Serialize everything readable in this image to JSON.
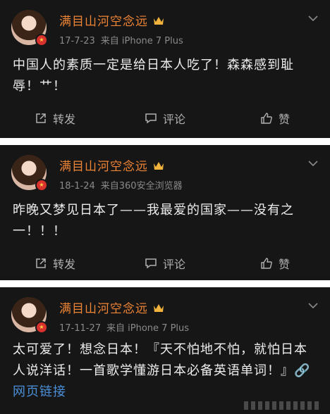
{
  "posts": [
    {
      "username": "满目山河空念远",
      "date": "17-7-23",
      "source": "来自 iPhone 7 Plus",
      "content": "中国人的素质一定是给日本人吃了！森森感到耻辱！艹！",
      "link": "",
      "actions": {
        "repost": "转发",
        "comment": "评论",
        "like": "赞"
      }
    },
    {
      "username": "满目山河空念远",
      "date": "18-1-24",
      "source": "来自360安全浏览器",
      "content": "昨晚又梦见日本了——我最爱的国家——没有之一！！！",
      "link": "",
      "actions": {
        "repost": "转发",
        "comment": "评论",
        "like": "赞"
      }
    },
    {
      "username": "满目山河空念远",
      "date": "17-11-27",
      "source": "来自 iPhone 7 Plus",
      "content": "太可爱了！想念日本！『天不怕地不怕，就怕日本人说洋话！一首歌学懂游日本必备英语单词！』",
      "link": "🔗网页链接",
      "actions": null
    }
  ],
  "colors": {
    "background": "#161616",
    "username": "#f08535",
    "meta": "#8a8a8a",
    "text": "#ececec",
    "link": "#4a8fd8",
    "separator": "#ffffff"
  },
  "icons": {
    "repost": "share-box-icon",
    "comment": "comment-bubble-icon",
    "like": "thumbs-up-icon",
    "crown": "crown-icon",
    "more": "chevron-down-icon"
  }
}
